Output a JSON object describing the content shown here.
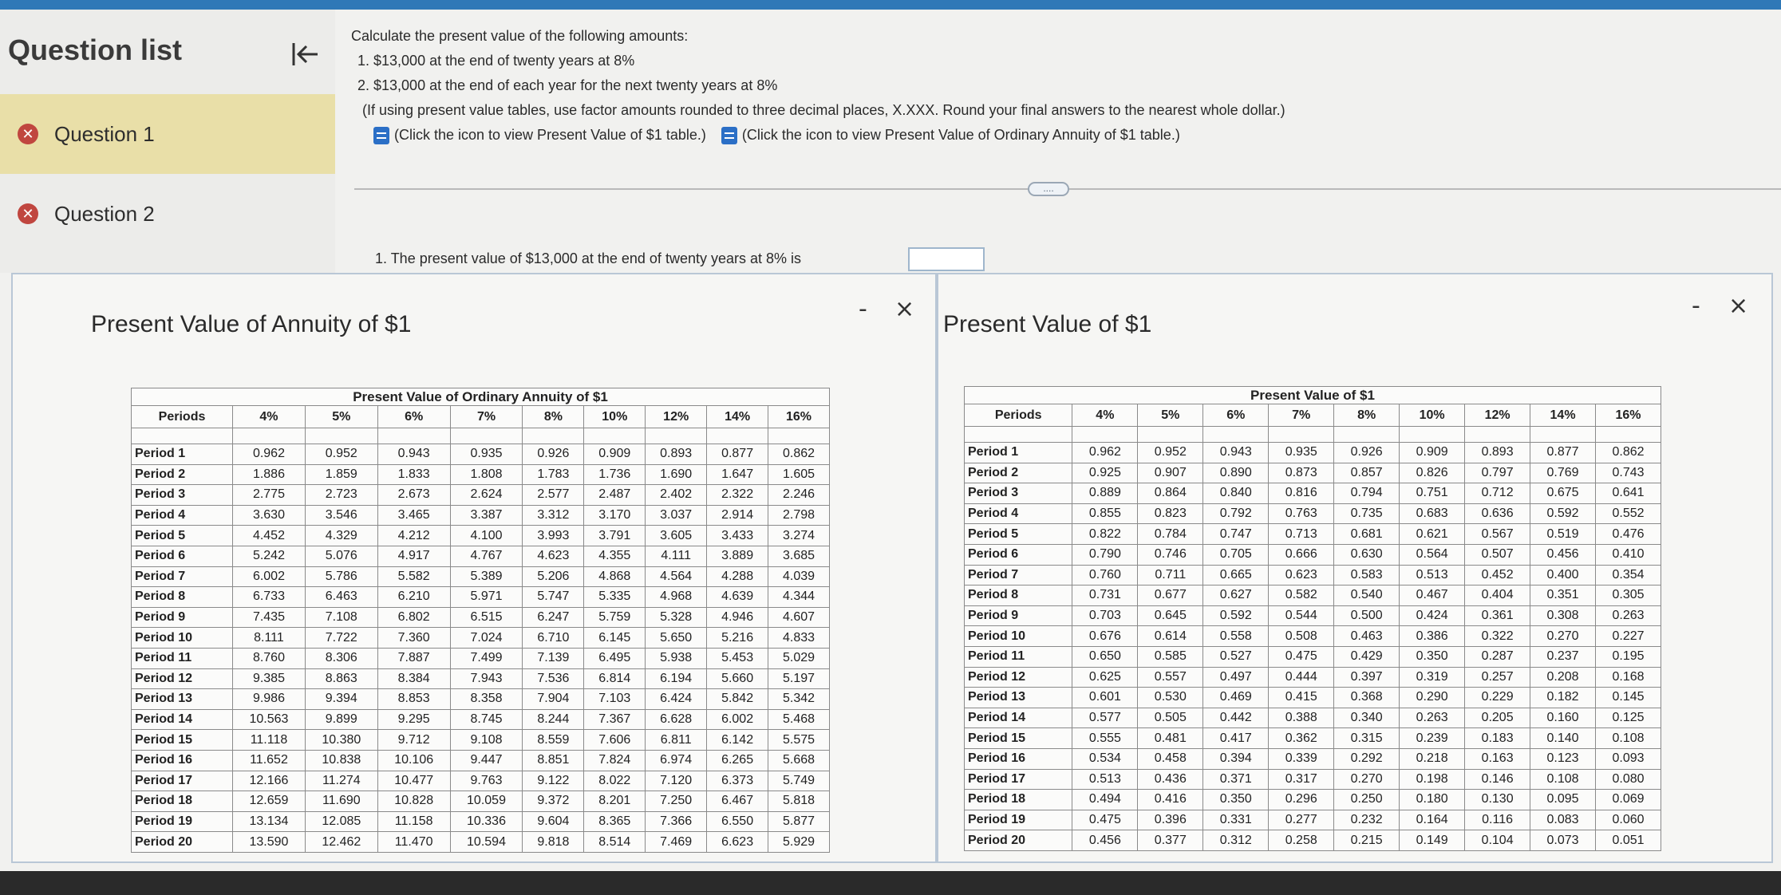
{
  "sidebar": {
    "title": "Question list",
    "collapse_icon": "collapse-left-icon",
    "questions": [
      {
        "label": "Question 1",
        "status": "incorrect",
        "active": true
      },
      {
        "label": "Question 2",
        "status": "incorrect",
        "active": false
      }
    ]
  },
  "question": {
    "prompt": "Calculate the present value of the following amounts:",
    "items": [
      "1. $13,000 at the end of twenty years at 8%",
      "2. $13,000 at the end of each year for the next twenty years at 8%"
    ],
    "note": "(If using present value tables, use factor amounts rounded to three decimal places, X.XXX. Round your final answers to the nearest whole dollar.)",
    "link_pv1": "(Click the icon to view Present Value of $1 table.)",
    "link_pva": "(Click the icon to view Present Value of Ordinary Annuity of $1 table.)",
    "more_label": "....",
    "answer_prompt": "1. The present value of $13,000 at the end of twenty years at 8% is",
    "answer_value": ""
  },
  "annuity_popup": {
    "title": "Present Value of Annuity of $1",
    "minimize": "-",
    "close": "×",
    "table_caption": "Present Value of Ordinary Annuity of $1",
    "columns": [
      "Periods",
      "4%",
      "5%",
      "6%",
      "7%",
      "8%",
      "10%",
      "12%",
      "14%",
      "16%"
    ],
    "rows": [
      [
        "Period 1",
        "0.962",
        "0.952",
        "0.943",
        "0.935",
        "0.926",
        "0.909",
        "0.893",
        "0.877",
        "0.862"
      ],
      [
        "Period 2",
        "1.886",
        "1.859",
        "1.833",
        "1.808",
        "1.783",
        "1.736",
        "1.690",
        "1.647",
        "1.605"
      ],
      [
        "Period 3",
        "2.775",
        "2.723",
        "2.673",
        "2.624",
        "2.577",
        "2.487",
        "2.402",
        "2.322",
        "2.246"
      ],
      [
        "Period 4",
        "3.630",
        "3.546",
        "3.465",
        "3.387",
        "3.312",
        "3.170",
        "3.037",
        "2.914",
        "2.798"
      ],
      [
        "Period 5",
        "4.452",
        "4.329",
        "4.212",
        "4.100",
        "3.993",
        "3.791",
        "3.605",
        "3.433",
        "3.274"
      ],
      [
        "Period 6",
        "5.242",
        "5.076",
        "4.917",
        "4.767",
        "4.623",
        "4.355",
        "4.111",
        "3.889",
        "3.685"
      ],
      [
        "Period 7",
        "6.002",
        "5.786",
        "5.582",
        "5.389",
        "5.206",
        "4.868",
        "4.564",
        "4.288",
        "4.039"
      ],
      [
        "Period 8",
        "6.733",
        "6.463",
        "6.210",
        "5.971",
        "5.747",
        "5.335",
        "4.968",
        "4.639",
        "4.344"
      ],
      [
        "Period 9",
        "7.435",
        "7.108",
        "6.802",
        "6.515",
        "6.247",
        "5.759",
        "5.328",
        "4.946",
        "4.607"
      ],
      [
        "Period 10",
        "8.111",
        "7.722",
        "7.360",
        "7.024",
        "6.710",
        "6.145",
        "5.650",
        "5.216",
        "4.833"
      ],
      [
        "Period 11",
        "8.760",
        "8.306",
        "7.887",
        "7.499",
        "7.139",
        "6.495",
        "5.938",
        "5.453",
        "5.029"
      ],
      [
        "Period 12",
        "9.385",
        "8.863",
        "8.384",
        "7.943",
        "7.536",
        "6.814",
        "6.194",
        "5.660",
        "5.197"
      ],
      [
        "Period 13",
        "9.986",
        "9.394",
        "8.853",
        "8.358",
        "7.904",
        "7.103",
        "6.424",
        "5.842",
        "5.342"
      ],
      [
        "Period 14",
        "10.563",
        "9.899",
        "9.295",
        "8.745",
        "8.244",
        "7.367",
        "6.628",
        "6.002",
        "5.468"
      ],
      [
        "Period 15",
        "11.118",
        "10.380",
        "9.712",
        "9.108",
        "8.559",
        "7.606",
        "6.811",
        "6.142",
        "5.575"
      ],
      [
        "Period 16",
        "11.652",
        "10.838",
        "10.106",
        "9.447",
        "8.851",
        "7.824",
        "6.974",
        "6.265",
        "5.668"
      ],
      [
        "Period 17",
        "12.166",
        "11.274",
        "10.477",
        "9.763",
        "9.122",
        "8.022",
        "7.120",
        "6.373",
        "5.749"
      ],
      [
        "Period 18",
        "12.659",
        "11.690",
        "10.828",
        "10.059",
        "9.372",
        "8.201",
        "7.250",
        "6.467",
        "5.818"
      ],
      [
        "Period 19",
        "13.134",
        "12.085",
        "11.158",
        "10.336",
        "9.604",
        "8.365",
        "7.366",
        "6.550",
        "5.877"
      ],
      [
        "Period 20",
        "13.590",
        "12.462",
        "11.470",
        "10.594",
        "9.818",
        "8.514",
        "7.469",
        "6.623",
        "5.929"
      ]
    ]
  },
  "pv1_popup": {
    "title": "Present Value of $1",
    "minimize": "-",
    "close": "×",
    "table_caption": "Present Value of $1",
    "columns": [
      "Periods",
      "4%",
      "5%",
      "6%",
      "7%",
      "8%",
      "10%",
      "12%",
      "14%",
      "16%"
    ],
    "rows": [
      [
        "Period 1",
        "0.962",
        "0.952",
        "0.943",
        "0.935",
        "0.926",
        "0.909",
        "0.893",
        "0.877",
        "0.862"
      ],
      [
        "Period 2",
        "0.925",
        "0.907",
        "0.890",
        "0.873",
        "0.857",
        "0.826",
        "0.797",
        "0.769",
        "0.743"
      ],
      [
        "Period 3",
        "0.889",
        "0.864",
        "0.840",
        "0.816",
        "0.794",
        "0.751",
        "0.712",
        "0.675",
        "0.641"
      ],
      [
        "Period 4",
        "0.855",
        "0.823",
        "0.792",
        "0.763",
        "0.735",
        "0.683",
        "0.636",
        "0.592",
        "0.552"
      ],
      [
        "Period 5",
        "0.822",
        "0.784",
        "0.747",
        "0.713",
        "0.681",
        "0.621",
        "0.567",
        "0.519",
        "0.476"
      ],
      [
        "Period 6",
        "0.790",
        "0.746",
        "0.705",
        "0.666",
        "0.630",
        "0.564",
        "0.507",
        "0.456",
        "0.410"
      ],
      [
        "Period 7",
        "0.760",
        "0.711",
        "0.665",
        "0.623",
        "0.583",
        "0.513",
        "0.452",
        "0.400",
        "0.354"
      ],
      [
        "Period 8",
        "0.731",
        "0.677",
        "0.627",
        "0.582",
        "0.540",
        "0.467",
        "0.404",
        "0.351",
        "0.305"
      ],
      [
        "Period 9",
        "0.703",
        "0.645",
        "0.592",
        "0.544",
        "0.500",
        "0.424",
        "0.361",
        "0.308",
        "0.263"
      ],
      [
        "Period 10",
        "0.676",
        "0.614",
        "0.558",
        "0.508",
        "0.463",
        "0.386",
        "0.322",
        "0.270",
        "0.227"
      ],
      [
        "Period 11",
        "0.650",
        "0.585",
        "0.527",
        "0.475",
        "0.429",
        "0.350",
        "0.287",
        "0.237",
        "0.195"
      ],
      [
        "Period 12",
        "0.625",
        "0.557",
        "0.497",
        "0.444",
        "0.397",
        "0.319",
        "0.257",
        "0.208",
        "0.168"
      ],
      [
        "Period 13",
        "0.601",
        "0.530",
        "0.469",
        "0.415",
        "0.368",
        "0.290",
        "0.229",
        "0.182",
        "0.145"
      ],
      [
        "Period 14",
        "0.577",
        "0.505",
        "0.442",
        "0.388",
        "0.340",
        "0.263",
        "0.205",
        "0.160",
        "0.125"
      ],
      [
        "Period 15",
        "0.555",
        "0.481",
        "0.417",
        "0.362",
        "0.315",
        "0.239",
        "0.183",
        "0.140",
        "0.108"
      ],
      [
        "Period 16",
        "0.534",
        "0.458",
        "0.394",
        "0.339",
        "0.292",
        "0.218",
        "0.163",
        "0.123",
        "0.093"
      ],
      [
        "Period 17",
        "0.513",
        "0.436",
        "0.371",
        "0.317",
        "0.270",
        "0.198",
        "0.146",
        "0.108",
        "0.080"
      ],
      [
        "Period 18",
        "0.494",
        "0.416",
        "0.350",
        "0.296",
        "0.250",
        "0.180",
        "0.130",
        "0.095",
        "0.069"
      ],
      [
        "Period 19",
        "0.475",
        "0.396",
        "0.331",
        "0.277",
        "0.232",
        "0.164",
        "0.116",
        "0.083",
        "0.060"
      ],
      [
        "Period 20",
        "0.456",
        "0.377",
        "0.312",
        "0.258",
        "0.215",
        "0.149",
        "0.104",
        "0.073",
        "0.051"
      ]
    ]
  },
  "colors": {
    "accent": "#2f78b7",
    "active_question": "#e9dfa8",
    "incorrect": "#c0463f"
  }
}
